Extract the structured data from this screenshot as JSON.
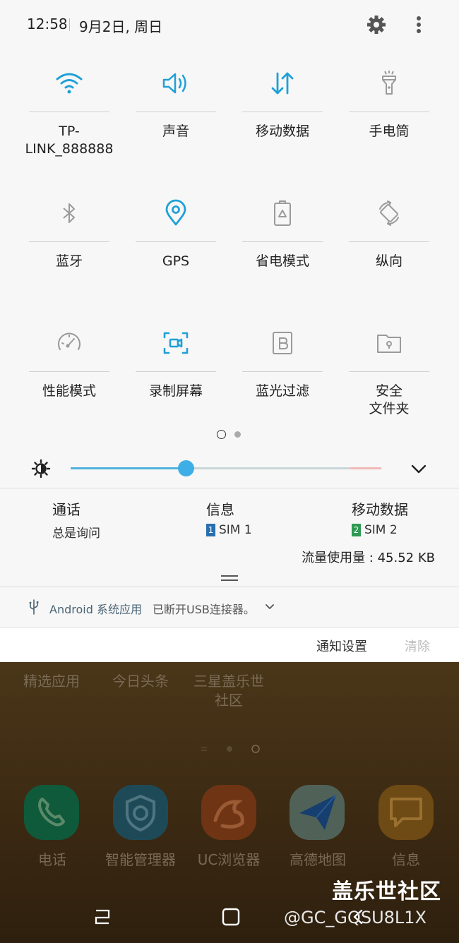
{
  "status": {
    "time": "12:58",
    "date": "9月2日, 周日"
  },
  "tiles": [
    {
      "label": "TP-\nLINK_888888",
      "icon": "wifi-icon",
      "active": true
    },
    {
      "label": "声音",
      "icon": "sound-icon",
      "active": true
    },
    {
      "label": "移动数据",
      "icon": "mobile-data-icon",
      "active": true
    },
    {
      "label": "手电筒",
      "icon": "flashlight-icon",
      "active": false
    },
    {
      "label": "蓝牙",
      "icon": "bluetooth-icon",
      "active": false
    },
    {
      "label": "GPS",
      "icon": "location-icon",
      "active": true
    },
    {
      "label": "省电模式",
      "icon": "battery-saver-icon",
      "active": false
    },
    {
      "label": "纵向",
      "icon": "rotation-icon",
      "active": false
    },
    {
      "label": "性能模式",
      "icon": "performance-icon",
      "active": false
    },
    {
      "label": "录制屏幕",
      "icon": "screen-record-icon",
      "active": true
    },
    {
      "label": "蓝光过滤",
      "icon": "blue-light-filter-icon",
      "active": false
    },
    {
      "label": "安全\n文件夹",
      "icon": "secure-folder-icon",
      "active": false
    }
  ],
  "brightness": {
    "level": 0.37
  },
  "sim": [
    {
      "title": "通话",
      "sub": "总是询问",
      "badge": "",
      "badge_color": ""
    },
    {
      "title": "信息",
      "sub": "SIM 1",
      "badge": "1",
      "badge_color": "#2a6fb0"
    },
    {
      "title": "移动数据",
      "sub": "SIM 2",
      "badge": "2",
      "badge_color": "#2e9a53"
    }
  ],
  "usage": "流量使用量 : 45.52 KB",
  "notification": {
    "app": "Android 系统应用",
    "message": "已断开USB连接器。"
  },
  "actions": {
    "settings": "通知设置",
    "clear": "清除"
  },
  "home": {
    "top_apps": [
      "精选应用",
      "今日头条",
      "三星盖乐世\n社区"
    ],
    "dock": [
      "电话",
      "智能管理器",
      "UC浏览器",
      "高德地图",
      "信息"
    ]
  },
  "watermark": {
    "line1": "盖乐世社区",
    "line2": "@GC_GQSU8L1X"
  },
  "colors": {
    "accent": "#1ea0d8",
    "inactive": "#9a9a9a"
  }
}
